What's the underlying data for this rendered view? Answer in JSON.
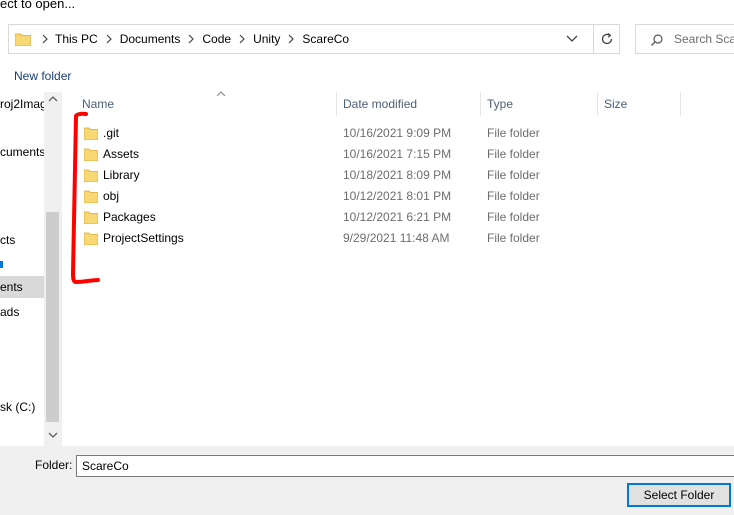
{
  "window": {
    "title": "ect to open..."
  },
  "address_bar": {
    "breadcrumbs": [
      "This PC",
      "Documents",
      "Code",
      "Unity",
      "ScareCo"
    ]
  },
  "search": {
    "placeholder": "Search Scar"
  },
  "command_bar": {
    "new_folder_label": "New folder"
  },
  "nav_pane": {
    "items": [
      "roj2Imag",
      "cuments",
      "cts",
      "ents",
      "ads",
      "sk (C:)"
    ],
    "selected_item": "ents"
  },
  "file_list": {
    "columns": {
      "name": "Name",
      "date_modified": "Date modified",
      "type": "Type",
      "size": "Size"
    },
    "rows": [
      {
        "name": ".git",
        "date_modified": "10/16/2021 9:09 PM",
        "type": "File folder"
      },
      {
        "name": "Assets",
        "date_modified": "10/16/2021 7:15 PM",
        "type": "File folder"
      },
      {
        "name": "Library",
        "date_modified": "10/18/2021 8:09 PM",
        "type": "File folder"
      },
      {
        "name": "obj",
        "date_modified": "10/12/2021 8:01 PM",
        "type": "File folder"
      },
      {
        "name": "Packages",
        "date_modified": "10/12/2021 6:21 PM",
        "type": "File folder"
      },
      {
        "name": "ProjectSettings",
        "date_modified": "9/29/2021 11:48 AM",
        "type": "File folder"
      }
    ]
  },
  "bottom": {
    "folder_label": "Folder:",
    "folder_value": "ScareCo",
    "select_button_label": "Select Folder"
  },
  "colors": {
    "folder_icon": "#f8d775",
    "accent": "#0078d7",
    "annotation": "#ff0000",
    "link": "#1a3e78"
  }
}
